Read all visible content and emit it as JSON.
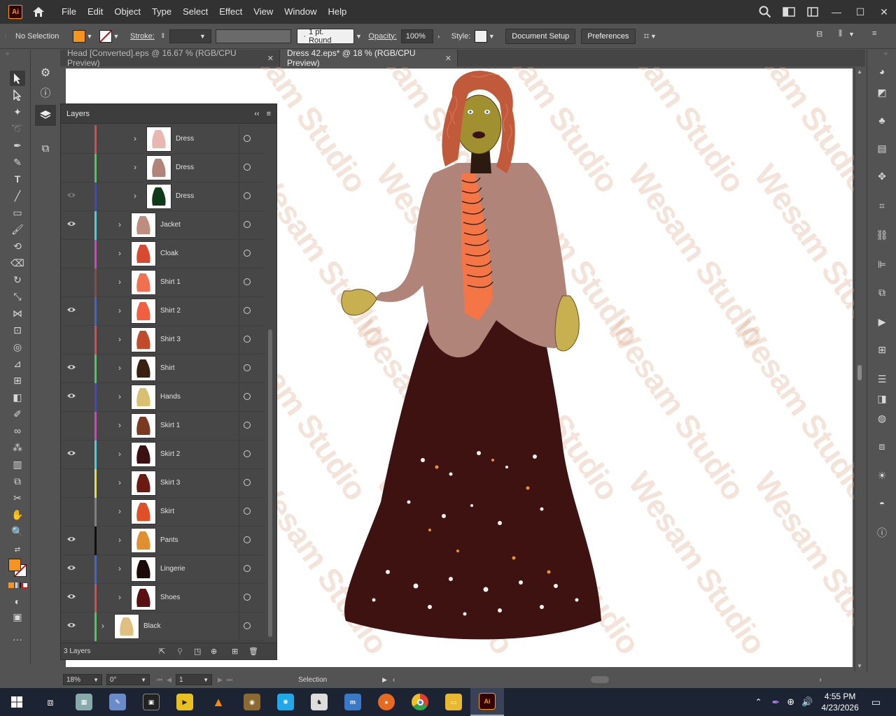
{
  "app": {
    "logo_text": "Ai",
    "menu": [
      "File",
      "Edit",
      "Object",
      "Type",
      "Select",
      "Effect",
      "View",
      "Window",
      "Help"
    ]
  },
  "control_bar": {
    "selection_status": "No Selection",
    "fill_color": "#f7941d",
    "stroke_label": "Stroke:",
    "stroke_profile": "1 pt. Round",
    "opacity_label": "Opacity:",
    "opacity_value": "100%",
    "style_label": "Style:",
    "document_setup": "Document Setup",
    "preferences": "Preferences"
  },
  "tabs": [
    {
      "label": "Head [Converted].eps @ 16.67 % (RGB/CPU Preview)",
      "active": false
    },
    {
      "label": "Dress 42.eps* @ 18 % (RGB/CPU Preview)",
      "active": true
    }
  ],
  "watermark": "Wesam Studio",
  "layers_panel": {
    "title": "Layers",
    "rows": [
      {
        "name": "Dress",
        "color": "#e0464b",
        "visible": false,
        "indent": 1,
        "thumb": "#e8b8b0"
      },
      {
        "name": "Dress",
        "color": "#3fd150",
        "visible": false,
        "indent": 1,
        "thumb": "#b08478"
      },
      {
        "name": "Dress",
        "color": "#3e45d0",
        "visible": true,
        "indent": 1,
        "thumb": "#0f3a1a",
        "eye_dim": true
      },
      {
        "name": "Jacket",
        "color": "#36d8e8",
        "visible": true,
        "indent": 0,
        "thumb": "#c08c80"
      },
      {
        "name": "Cloak",
        "color": "#d83fd0",
        "visible": false,
        "indent": 0,
        "thumb": "#d84a30"
      },
      {
        "name": "Shirt 1",
        "color": "#8a4a4a",
        "visible": false,
        "indent": 0,
        "thumb": "#f07050"
      },
      {
        "name": "Shirt 2",
        "color": "#3e65d8",
        "visible": true,
        "indent": 0,
        "thumb": "#f06040"
      },
      {
        "name": "Shirt 3",
        "color": "#e0464b",
        "visible": false,
        "indent": 0,
        "thumb": "#c04a2a"
      },
      {
        "name": "Shirt",
        "color": "#3fd150",
        "visible": true,
        "indent": 0,
        "thumb": "#3a2010"
      },
      {
        "name": "Hands",
        "color": "#3e45d0",
        "visible": true,
        "indent": 0,
        "thumb": "#d8c070"
      },
      {
        "name": "Skirt 1",
        "color": "#d83fd0",
        "visible": false,
        "indent": 0,
        "thumb": "#7a3a20"
      },
      {
        "name": "Skirt 2",
        "color": "#36d8e8",
        "visible": true,
        "indent": 0,
        "thumb": "#3a1010"
      },
      {
        "name": "Skirt 3",
        "color": "#e8e030",
        "visible": false,
        "indent": 0,
        "thumb": "#6a1a10"
      },
      {
        "name": "Skirt",
        "color": "#808080",
        "visible": false,
        "indent": 0,
        "thumb": "#e05028"
      },
      {
        "name": "Pants",
        "color": "#111111",
        "visible": true,
        "indent": 0,
        "thumb": "#e09030"
      },
      {
        "name": "Lingerie",
        "color": "#3e65d8",
        "visible": true,
        "indent": 0,
        "thumb": "#1a0a0a"
      },
      {
        "name": "Shoes",
        "color": "#e0464b",
        "visible": true,
        "indent": 0,
        "thumb": "#5a1010"
      },
      {
        "name": "Black",
        "color": "#3fd150",
        "visible": true,
        "indent": -1,
        "thumb": "#e0c080"
      }
    ],
    "footer_count": "3 Layers"
  },
  "status_bar": {
    "zoom": "18%",
    "rotation": "0°",
    "artboard": "1",
    "tool": "Selection"
  },
  "taskbar": {
    "time": "4:55 PM",
    "date": "4/23/2026"
  }
}
